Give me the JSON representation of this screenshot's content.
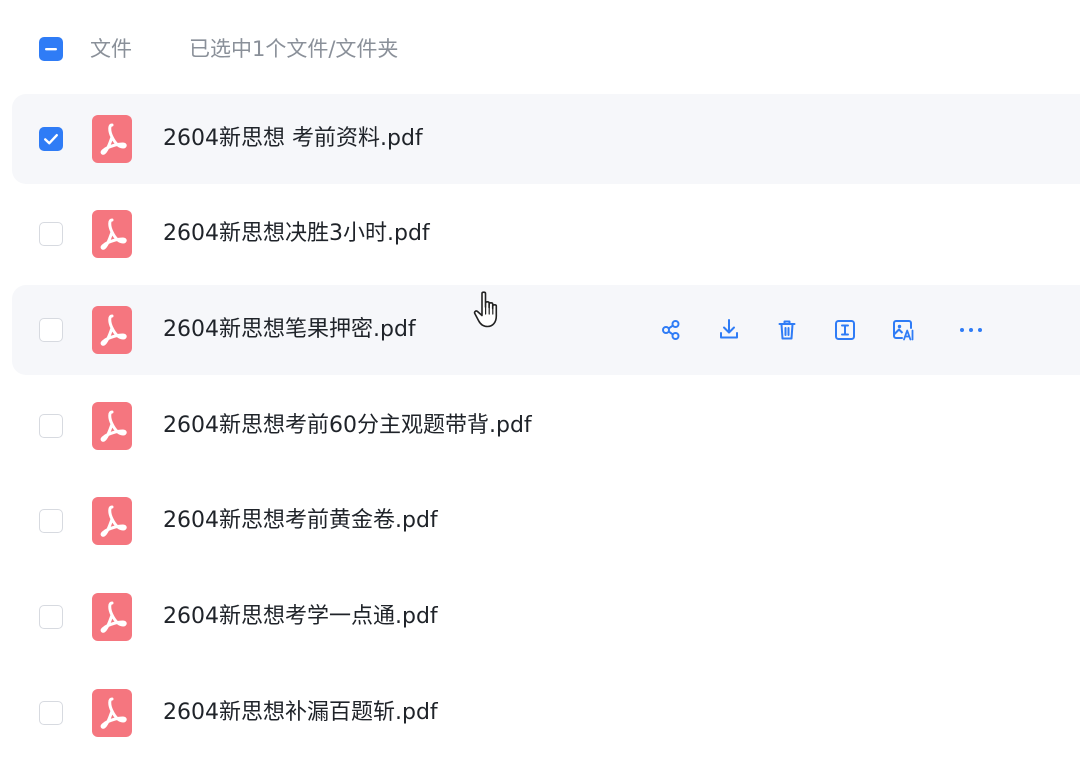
{
  "header": {
    "select_all_state": "partial",
    "column_label": "文件",
    "selection_status": "已选中1个文件/文件夹"
  },
  "colors": {
    "accent": "#2f7cf6",
    "pdf_icon": "#f5767f",
    "row_highlight": "#f6f7fa",
    "muted_text": "#8a9099"
  },
  "files": [
    {
      "name": "2604新思想 考前资料.pdf",
      "checked": true,
      "highlighted": true
    },
    {
      "name": "2604新思想决胜3小时.pdf",
      "checked": false,
      "highlighted": false
    },
    {
      "name": "2604新思想笔果押密.pdf",
      "checked": false,
      "highlighted": true,
      "hovered": true
    },
    {
      "name": "2604新思想考前60分主观题带背.pdf",
      "checked": false,
      "highlighted": false
    },
    {
      "name": "2604新思想考前黄金卷.pdf",
      "checked": false,
      "highlighted": false
    },
    {
      "name": "2604新思想考学一点通.pdf",
      "checked": false,
      "highlighted": false
    },
    {
      "name": "2604新思想补漏百题斩.pdf",
      "checked": false,
      "highlighted": false
    }
  ],
  "row_actions": [
    "share-icon",
    "download-icon",
    "delete-icon",
    "rename-icon",
    "image-translate-icon",
    "more-icon"
  ]
}
